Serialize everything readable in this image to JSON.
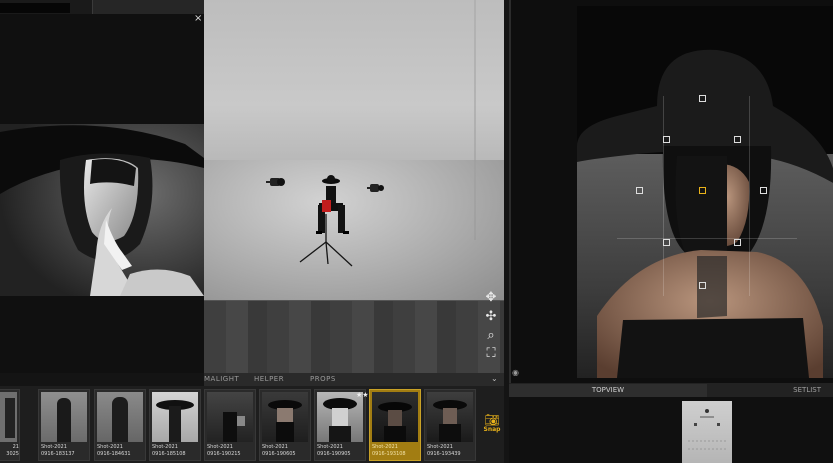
{
  "preview": {
    "close_label": "×"
  },
  "studio": {
    "tools": [
      {
        "name": "orbit-icon",
        "glyph": "✥"
      },
      {
        "name": "pan-icon",
        "glyph": "✣"
      },
      {
        "name": "zoom-icon",
        "glyph": "⌕"
      },
      {
        "name": "fit-view-icon",
        "glyph": "⛶"
      }
    ]
  },
  "tabs": {
    "items": [
      "MALIGHT",
      "HELPER",
      "PROPS"
    ],
    "chevron": "⌄"
  },
  "filmstrip": {
    "thumbs": [
      {
        "title": "21",
        "stamp": "3025",
        "selected": false
      },
      {
        "title": "Shot-2021",
        "stamp": "0916-183137",
        "selected": false
      },
      {
        "title": "Shot-2021",
        "stamp": "0916-184631",
        "selected": false
      },
      {
        "title": "Shot-2021",
        "stamp": "0916-185108",
        "selected": false
      },
      {
        "title": "Shot-2021",
        "stamp": "0916-190215",
        "selected": false
      },
      {
        "title": "Shot-2021",
        "stamp": "0916-190605",
        "selected": false
      },
      {
        "title": "Shot-2021",
        "stamp": "0916-190905",
        "selected": false
      },
      {
        "title": "Shot-2021",
        "stamp": "0916-193108",
        "selected": true
      },
      {
        "title": "Shot-2021",
        "stamp": "0916-193439",
        "selected": false
      }
    ],
    "rating_stars": "★★★",
    "snap_label": "Snap"
  },
  "right_panel": {
    "tab_topview": "TOPVIEW",
    "tab_setlist": "SETLIST"
  },
  "colors": {
    "accent": "#e9b21a",
    "selected_thumb": "#a27d12"
  }
}
